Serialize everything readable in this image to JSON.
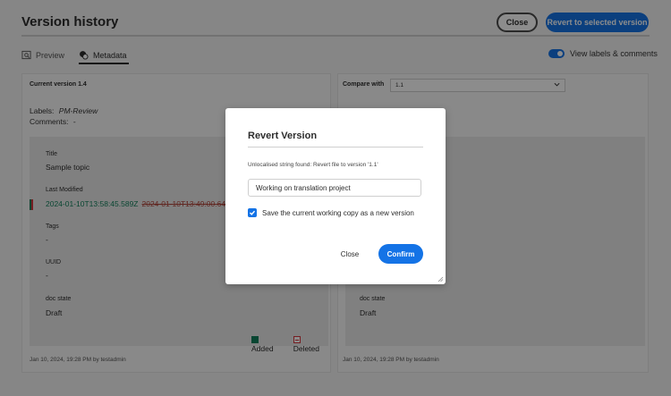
{
  "header": {
    "title": "Version history",
    "close_label": "Close",
    "revert_label": "Revert to selected version"
  },
  "tabs": [
    {
      "label": "Preview",
      "icon": "preview-icon",
      "active": false
    },
    {
      "label": "Metadata",
      "icon": "metadata-icon",
      "active": true
    }
  ],
  "toggle": {
    "label": "View labels & comments",
    "on": true
  },
  "left_panel": {
    "heading": "Current version 1.4",
    "labels_key": "Labels:",
    "labels_val": "PM-Review",
    "comments_key": "Comments:",
    "comments_val": "-",
    "fields": [
      {
        "label": "Title",
        "value": "Sample topic"
      },
      {
        "label": "Last Modified",
        "added": "2024-01-10T13:58:45.589Z",
        "deleted": "2024-01-10T13:49:00.647Z"
      },
      {
        "label": "Tags",
        "value": "-"
      },
      {
        "label": "UUID",
        "value": "-"
      },
      {
        "label": "doc state",
        "value": "Draft"
      }
    ],
    "legend": {
      "added": "Added",
      "deleted": "Deleted"
    },
    "footer": "Jan 10, 2024, 19:28 PM by testadmin"
  },
  "right_panel": {
    "compare_label": "Compare with",
    "compare_value": "1.1",
    "fields": [
      {
        "label": "doc state",
        "value": "Draft"
      }
    ],
    "footer": "Jan 10, 2024, 19:28 PM by testadmin"
  },
  "modal": {
    "title": "Revert Version",
    "message": "Unlocalised string found: Revert file to version '1.1'",
    "input_value": "Working on translation project",
    "checkbox_label": "Save the current working copy as a new version",
    "checkbox_checked": true,
    "close_label": "Close",
    "confirm_label": "Confirm"
  },
  "colors": {
    "accent": "#1473e6",
    "added": "#12805c",
    "deleted": "#d7373f"
  }
}
